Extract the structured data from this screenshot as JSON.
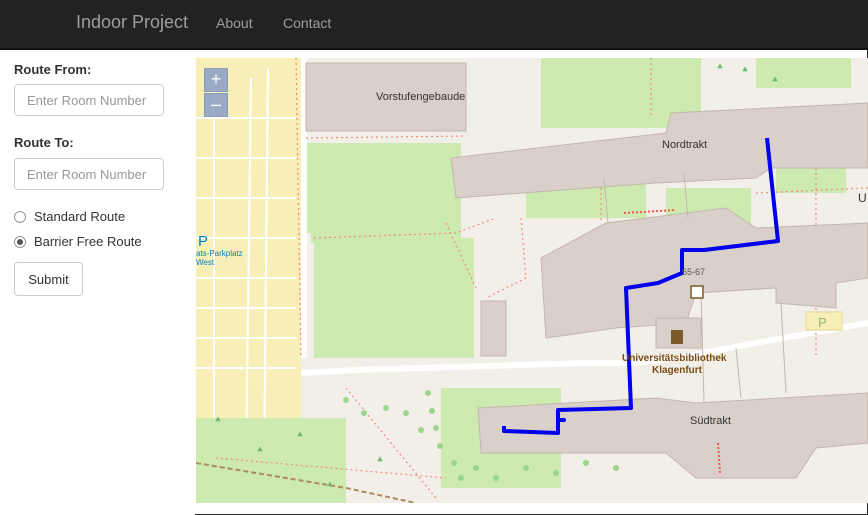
{
  "navbar": {
    "brand": "Indoor Project",
    "links": [
      {
        "label": "About"
      },
      {
        "label": "Contact"
      }
    ]
  },
  "form": {
    "route_from_label": "Route From:",
    "route_from_placeholder": "Enter Room Number",
    "route_to_label": "Route To:",
    "route_to_placeholder": "Enter Room Number",
    "route_options": [
      {
        "label": "Standard Route",
        "checked": false
      },
      {
        "label": "Barrier Free Route",
        "checked": true
      }
    ],
    "submit_label": "Submit"
  },
  "map": {
    "zoom_in": "+",
    "zoom_out": "–",
    "labels": {
      "vorstufengebaude": "Vorstufengebaude",
      "nordtrakt": "Nordtrakt",
      "suedtrakt": "Südtrakt",
      "library_line1": "Universitätsbibliothek",
      "library_line2": "Klagenfurt",
      "house_number": "65-67",
      "parking_symbol_left": "P",
      "parking_text_line1": "ats-Parkplatz",
      "parking_text_line2": "West",
      "parking_symbol_right": "P",
      "edge_letter": "U"
    },
    "colors": {
      "route": "#0000ee",
      "building": "#d9d0c9",
      "grass": "#cdebb0",
      "parking": "#f7efb7"
    }
  }
}
